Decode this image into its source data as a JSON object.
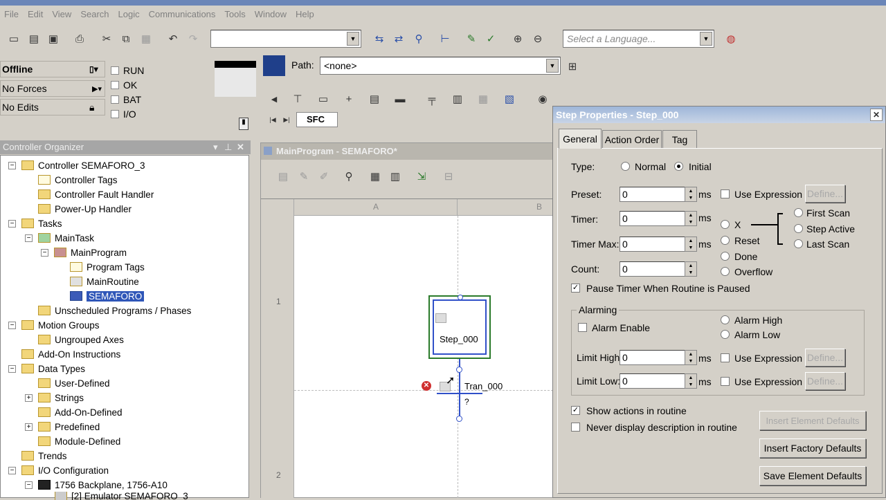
{
  "menu": [
    "File",
    "Edit",
    "View",
    "Search",
    "Logic",
    "Communications",
    "Tools",
    "Window",
    "Help"
  ],
  "toolbar": {
    "combo_value": "",
    "language_placeholder": "Select a Language...",
    "path_label": "Path:",
    "path_value": "<none>"
  },
  "status": {
    "mode": "Offline",
    "forces": "No Forces",
    "edits": "No Edits",
    "flags": [
      "RUN",
      "OK",
      "BAT",
      "I/O"
    ]
  },
  "ladder_tab": "SFC",
  "organizer": {
    "title": "Controller Organizer",
    "items": [
      {
        "label": "Controller SEMAFORO_3"
      },
      {
        "label": "Controller Tags"
      },
      {
        "label": "Controller Fault Handler"
      },
      {
        "label": "Power-Up Handler"
      },
      {
        "label": "Tasks"
      },
      {
        "label": "MainTask"
      },
      {
        "label": "MainProgram"
      },
      {
        "label": "Program Tags"
      },
      {
        "label": "MainRoutine"
      },
      {
        "label": "SEMAFORO"
      },
      {
        "label": "Unscheduled Programs / Phases"
      },
      {
        "label": "Motion Groups"
      },
      {
        "label": "Ungrouped Axes"
      },
      {
        "label": "Add-On Instructions"
      },
      {
        "label": "Data Types"
      },
      {
        "label": "User-Defined"
      },
      {
        "label": "Strings"
      },
      {
        "label": "Add-On-Defined"
      },
      {
        "label": "Predefined"
      },
      {
        "label": "Module-Defined"
      },
      {
        "label": "Trends"
      },
      {
        "label": "I/O Configuration"
      },
      {
        "label": "1756 Backplane, 1756-A10"
      },
      {
        "label": "[2] Emulator SEMAFORO_3"
      }
    ]
  },
  "editor": {
    "title": "MainProgram - SEMAFORO*",
    "col_a": "A",
    "col_b": "B",
    "row1": "1",
    "row2": "2",
    "step_label": "Step_000",
    "tran_label": "Tran_000",
    "tran_cond": "?"
  },
  "dialog": {
    "title": "Step Properties - Step_000",
    "tabs": [
      "General",
      "Action Order",
      "Tag"
    ],
    "type_label": "Type:",
    "type_normal": "Normal",
    "type_initial": "Initial",
    "preset_label": "Preset:",
    "preset_value": "0",
    "timer_label": "Timer:",
    "timer_value": "0",
    "timermax_label": "Timer Max:",
    "timermax_value": "0",
    "count_label": "Count:",
    "count_value": "0",
    "ms": "ms",
    "use_expression": "Use Expression",
    "define": "Define...",
    "x": "X",
    "reset": "Reset",
    "done": "Done",
    "overflow": "Overflow",
    "first_scan": "First Scan",
    "step_active": "Step Active",
    "last_scan": "Last Scan",
    "pause_timer": "Pause Timer When Routine is Paused",
    "alarming": "Alarming",
    "alarm_enable": "Alarm Enable",
    "alarm_high": "Alarm High",
    "alarm_low": "Alarm Low",
    "limit_high_label": "Limit High:",
    "limit_high_value": "0",
    "limit_low_label": "Limit Low:",
    "limit_low_value": "0",
    "show_actions": "Show actions in routine",
    "never_display": "Never display description in routine",
    "insert_element_defaults": "Insert Element Defaults",
    "insert_factory_defaults": "Insert Factory Defaults",
    "save_element_defaults": "Save Element Defaults"
  }
}
